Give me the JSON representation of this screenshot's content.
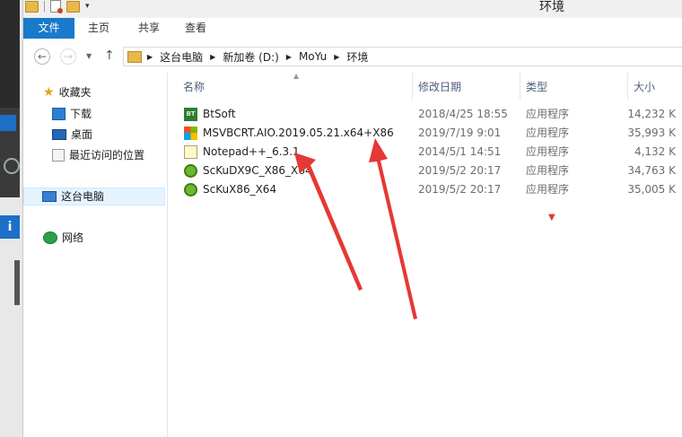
{
  "window": {
    "title": "环境"
  },
  "ribbon": {
    "tabs": [
      "文件",
      "主页",
      "共享",
      "查看"
    ]
  },
  "breadcrumb": [
    "这台电脑",
    "新加卷 (D:)",
    "MoYu",
    "环境"
  ],
  "nav": {
    "favorites": "收藏夹",
    "downloads": "下载",
    "desktop": "桌面",
    "recent": "最近访问的位置",
    "this_pc": "这台电脑",
    "network": "网络"
  },
  "columns": {
    "name": "名称",
    "date": "修改日期",
    "type": "类型",
    "size": "大小"
  },
  "files": [
    {
      "name": "BtSoft",
      "date": "2018/4/25 18:55",
      "type": "应用程序",
      "size": "14,232 K",
      "icon": "btsoft-icon"
    },
    {
      "name": "MSVBCRT.AIO.2019.05.21.x64+X86",
      "date": "2019/7/19 9:01",
      "type": "应用程序",
      "size": "35,993 K",
      "icon": "msvbcrt-icon"
    },
    {
      "name": "Notepad++_6.3.1",
      "date": "2014/5/1 14:51",
      "type": "应用程序",
      "size": "4,132 K",
      "icon": "notepad-icon"
    },
    {
      "name": "ScKuDX9C_X86_X64",
      "date": "2019/5/2 20:17",
      "type": "应用程序",
      "size": "34,763 K",
      "icon": "scku-icon"
    },
    {
      "name": "ScKuX86_X64",
      "date": "2019/5/2 20:17",
      "type": "应用程序",
      "size": "35,005 K",
      "icon": "scku-icon"
    }
  ],
  "colors": {
    "accent": "#1979ca",
    "selection": "#e5f3ff",
    "annotation": "#e53935"
  }
}
